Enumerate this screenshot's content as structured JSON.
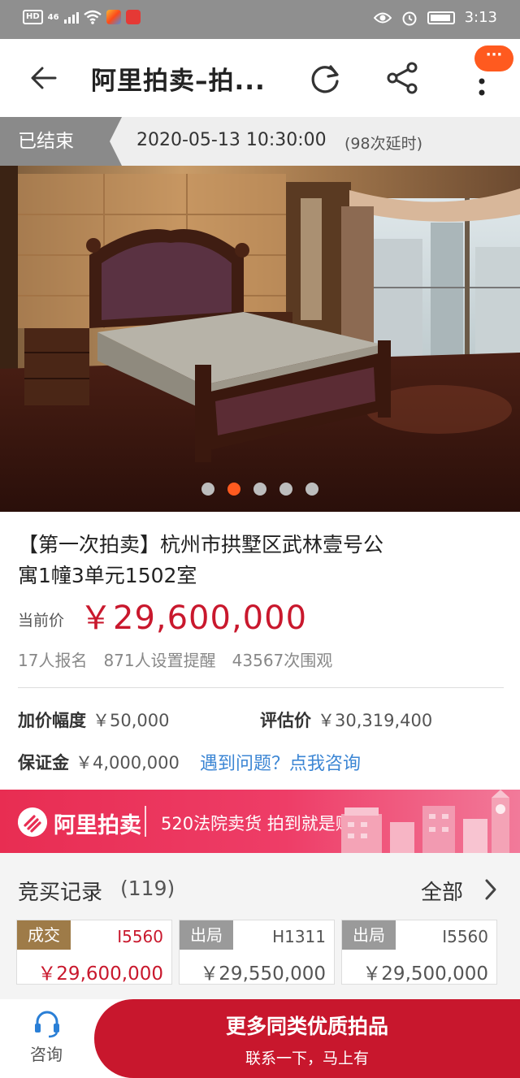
{
  "status_bar": {
    "network": "46",
    "hd": "HD",
    "time": "3:13"
  },
  "nav": {
    "title": "阿里拍卖–拍...",
    "badge": "···"
  },
  "auction_status": {
    "status": "已结束",
    "end_time": "2020-05-13 10:30:00",
    "delay": "(98次延时)"
  },
  "carousel": {
    "total": 5,
    "active_index": 1
  },
  "lot": {
    "title": "【第一次拍卖】杭州市拱墅区武林壹号公寓1幢3单元1502室",
    "price_label": "当前价",
    "price": "￥29,600,000",
    "stats": {
      "registered": "17人报名",
      "reminders": "871人设置提醒",
      "views": "43567次围观"
    },
    "increment_label": "加价幅度",
    "increment": "￥50,000",
    "appraisal_label": "评估价",
    "appraisal": "￥30,319,400",
    "deposit_label": "保证金",
    "deposit": "￥4,000,000",
    "help_link": "遇到问题？点我咨询"
  },
  "banner": {
    "brand": "阿里拍卖",
    "text": "520法院卖货 拍到就是赚到"
  },
  "bid_records": {
    "title": "竞买记录",
    "count": "(119)",
    "all_label": "全部",
    "items": [
      {
        "tag": "成交",
        "bidder": "I5560",
        "amount": "￥29,600,000"
      },
      {
        "tag": "出局",
        "bidder": "H1311",
        "amount": "￥29,550,000"
      },
      {
        "tag": "出局",
        "bidder": "I5560",
        "amount": "￥29,500,000"
      }
    ]
  },
  "bottom_bar": {
    "consult_label": "咨询",
    "cta_main": "更多同类优质拍品",
    "cta_sub": "联系一下，马上有"
  },
  "colors": {
    "accent_orange": "#ff5a1f",
    "price_red": "#c9182d",
    "cta_red": "#c8172d",
    "link_blue": "#3c86d4",
    "deal_tag": "#9e7b48",
    "out_tag": "#9a9a9a"
  },
  "icons": {
    "back": "arrow-left-icon",
    "refresh": "refresh-icon",
    "share": "share-icon",
    "more": "more-vertical-icon",
    "consult": "headset-icon",
    "all": "chevron-right-icon"
  }
}
